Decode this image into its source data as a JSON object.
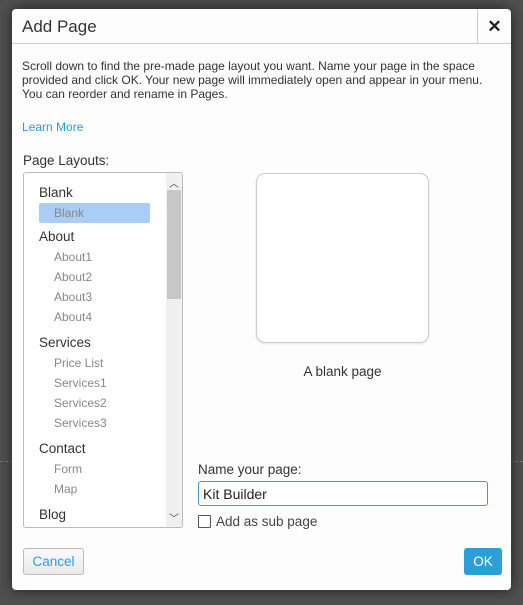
{
  "dialog": {
    "title": "Add Page",
    "close_icon": "close-icon",
    "intro": "Scroll down to find the pre-made page layout you want. Name your page in the space provided and click OK. Your new page will immediately open and appear in your menu. You can reorder and rename in Pages.",
    "learn_more": "Learn More",
    "layouts_label": "Page Layouts:",
    "groups": [
      {
        "label": "Blank",
        "items": [
          "Blank"
        ]
      },
      {
        "label": "About",
        "items": [
          "About1",
          "About2",
          "About3",
          "About4"
        ]
      },
      {
        "label": "Services",
        "items": [
          "Price List",
          "Services1",
          "Services2",
          "Services3"
        ]
      },
      {
        "label": "Contact",
        "items": [
          "Form",
          "Map"
        ]
      },
      {
        "label": "Blog",
        "items": []
      }
    ],
    "selected_layout": "Blank",
    "preview_caption": "A blank page",
    "name_label": "Name your page:",
    "name_value": "Kit Builder",
    "subpage_label": "Add as sub page",
    "subpage_checked": false,
    "cancel_label": "Cancel",
    "ok_label": "OK",
    "accent_color": "#2a9fd8",
    "selection_color": "#a9cdf7"
  }
}
